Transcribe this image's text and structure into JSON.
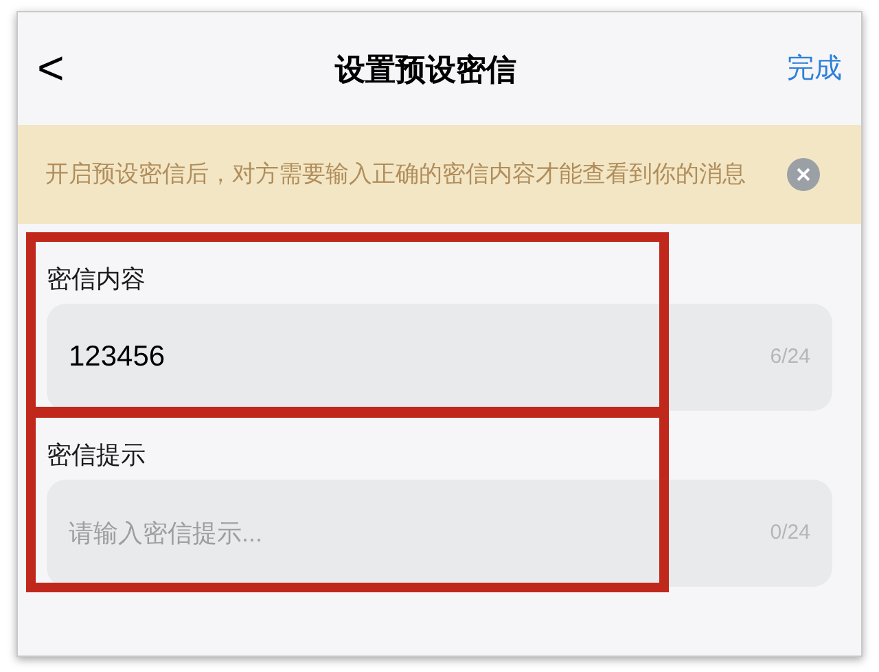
{
  "header": {
    "back": "<",
    "title": "设置预设密信",
    "done": "完成"
  },
  "notice": {
    "text": "开启预设密信后，对方需要输入正确的密信内容才能查看到你的消息"
  },
  "fields": [
    {
      "label": "密信内容",
      "value": "123456",
      "counter": "6/24",
      "highlighted": true
    },
    {
      "label": "密信提示",
      "placeholder": "请输入密信提示...",
      "counter": "0/24",
      "highlighted": true
    }
  ]
}
